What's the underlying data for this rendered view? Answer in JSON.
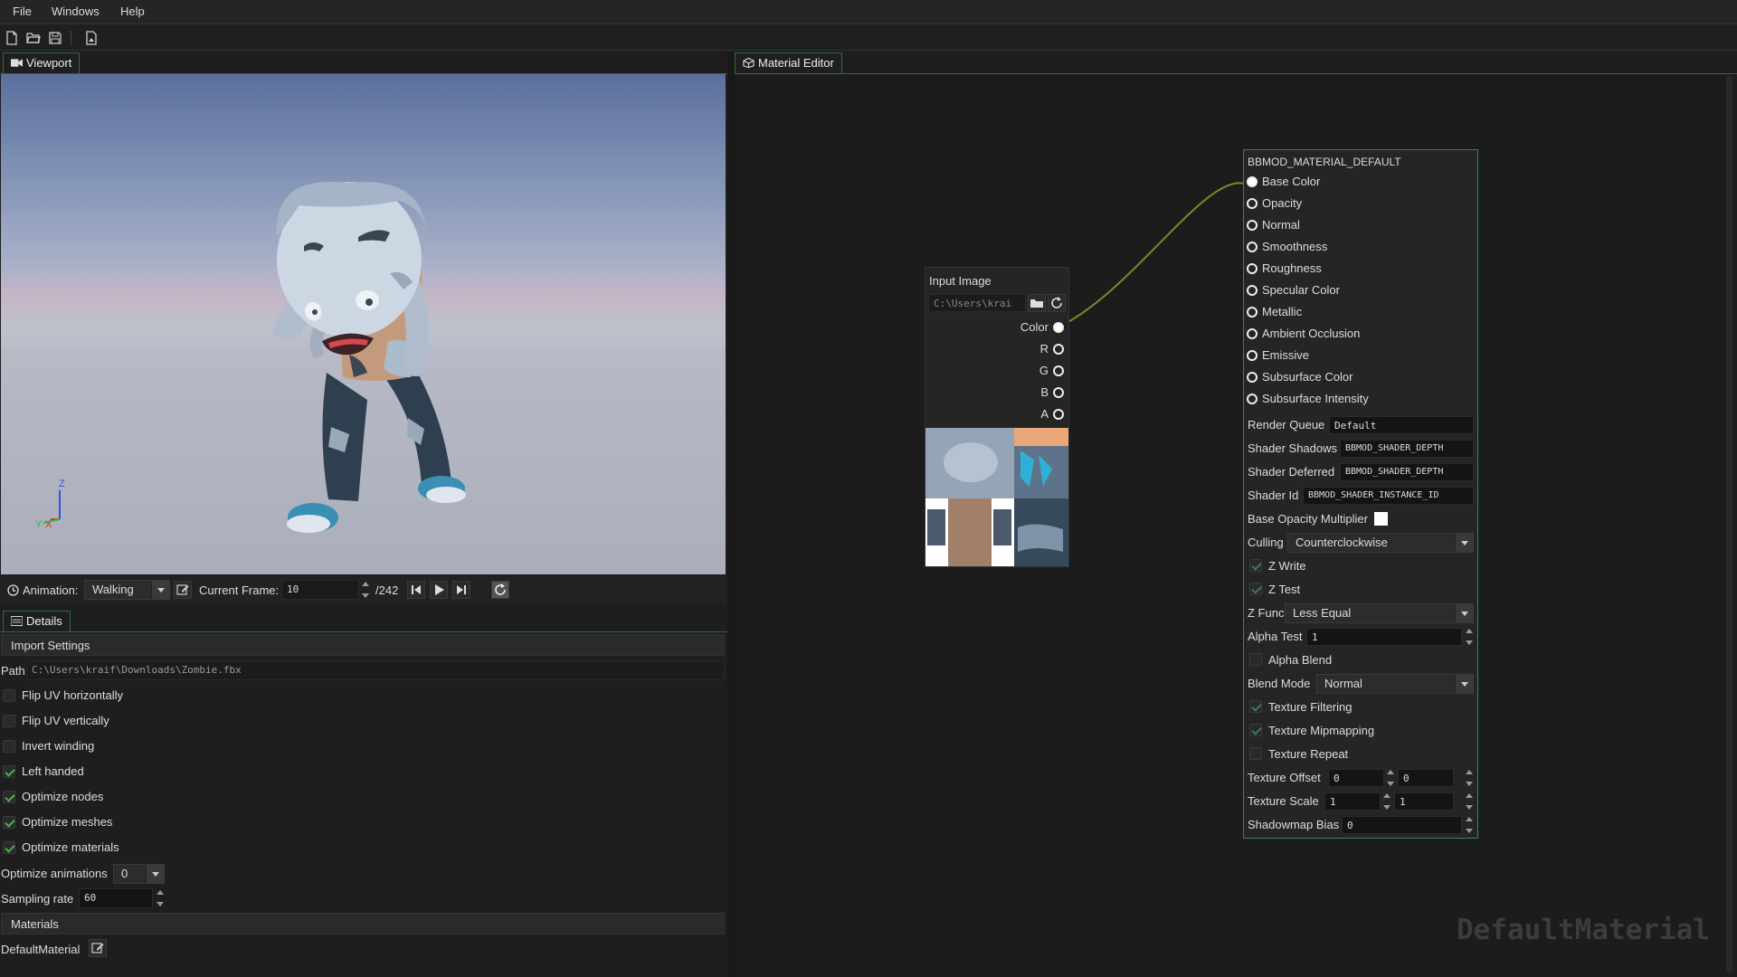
{
  "menu": [
    "File",
    "Windows",
    "Help"
  ],
  "toolbar": {
    "icons": [
      "new-file-icon",
      "open-folder-icon",
      "save-icon",
      "export-icon"
    ]
  },
  "viewport_tab": {
    "label": "Viewport"
  },
  "editor_tab": {
    "label": "Material Editor"
  },
  "axis_gizmo": {
    "z": "Z",
    "x": "X",
    "y": "Y"
  },
  "animation": {
    "label": "Animation:",
    "selected": "Walking",
    "current_frame_label": "Current Frame:",
    "current_frame": "10",
    "total_frames": "/242"
  },
  "details_tab": {
    "label": "Details"
  },
  "import_settings": {
    "header": "Import Settings",
    "path_label": "Path",
    "path_value": "C:\\Users\\kraif\\Downloads\\Zombie.fbx",
    "options": [
      {
        "label": "Flip UV horizontally",
        "checked": false
      },
      {
        "label": "Flip UV vertically",
        "checked": false
      },
      {
        "label": "Invert winding",
        "checked": false
      },
      {
        "label": "Left handed",
        "checked": true
      },
      {
        "label": "Optimize nodes",
        "checked": true
      },
      {
        "label": "Optimize meshes",
        "checked": true
      },
      {
        "label": "Optimize materials",
        "checked": true
      }
    ],
    "optimize_animations_label": "Optimize animations",
    "optimize_animations_value": "0",
    "sampling_rate_label": "Sampling rate",
    "sampling_rate_value": "60"
  },
  "materials": {
    "header": "Materials",
    "items": [
      {
        "label": "DefaultMaterial"
      }
    ]
  },
  "input_image_node": {
    "title": "Input Image",
    "path": "C:\\Users\\krai",
    "outputs": [
      "Color",
      "R",
      "G",
      "B",
      "A"
    ]
  },
  "material_node": {
    "title": "BBMOD_MATERIAL_DEFAULT",
    "inputs": [
      "Base Color",
      "Opacity",
      "Normal",
      "Smoothness",
      "Roughness",
      "Specular Color",
      "Metallic",
      "Ambient Occlusion",
      "Emissive",
      "Subsurface Color",
      "Subsurface Intensity"
    ],
    "render_queue_label": "Render Queue",
    "render_queue": "Default",
    "shader_shadows_label": "Shader Shadows",
    "shader_shadows": "BBMOD_SHADER_DEPTH",
    "shader_deferred_label": "Shader Deferred",
    "shader_deferred": "BBMOD_SHADER_DEPTH",
    "shader_id_label": "Shader Id",
    "shader_id": "BBMOD_SHADER_INSTANCE_ID",
    "base_opacity_label": "Base Opacity Multiplier",
    "culling_label": "Culling",
    "culling": "Counterclockwise",
    "z_write_label": "Z Write",
    "z_write": true,
    "z_test_label": "Z Test",
    "z_test": true,
    "z_func_label": "Z Func",
    "z_func": "Less Equal",
    "alpha_test_label": "Alpha Test",
    "alpha_test": "1",
    "alpha_blend_label": "Alpha Blend",
    "alpha_blend": false,
    "blend_mode_label": "Blend Mode",
    "blend_mode": "Normal",
    "texture_filtering_label": "Texture Filtering",
    "texture_filtering": true,
    "texture_mipmapping_label": "Texture Mipmapping",
    "texture_mipmapping": true,
    "texture_repeat_label": "Texture Repeat",
    "texture_repeat": false,
    "texture_offset_label": "Texture Offset",
    "texture_offset_x": "0",
    "texture_offset_y": "0",
    "texture_scale_label": "Texture Scale",
    "texture_scale_x": "1",
    "texture_scale_y": "1",
    "shadowmap_bias_label": "Shadowmap Bias",
    "shadowmap_bias": "0"
  },
  "watermark": "DefaultMaterial",
  "colors": {
    "accent": "#2e6b48",
    "link": "#7a8a24"
  }
}
